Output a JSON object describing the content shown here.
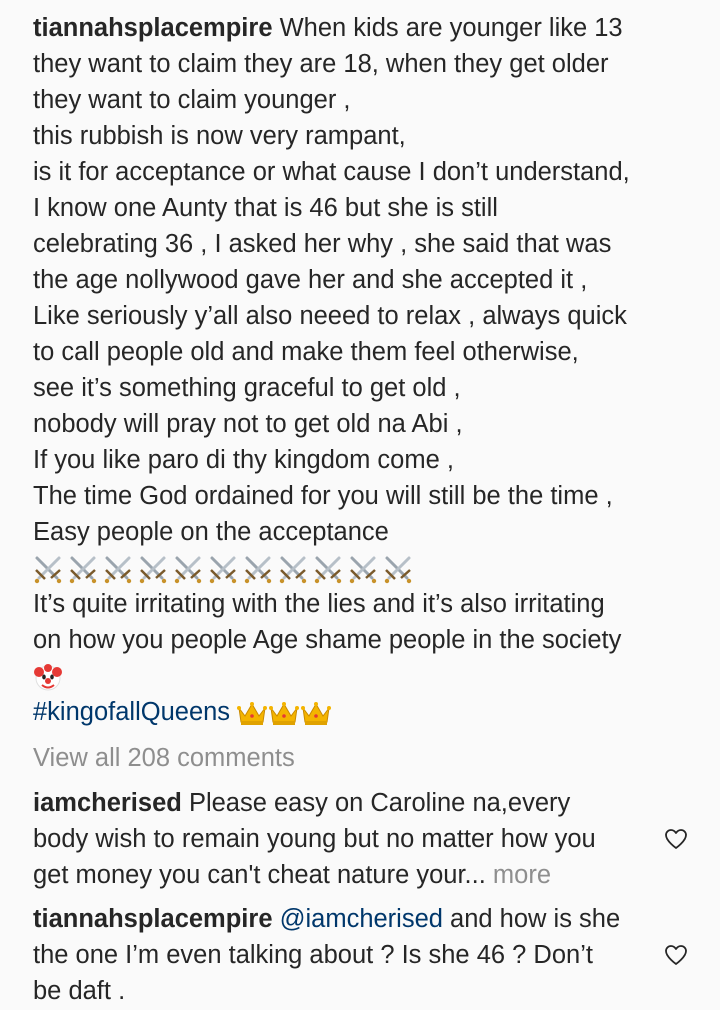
{
  "post": {
    "username": "tiannahsplacempire",
    "caption_first": "When kids are younger like 13",
    "lines": [
      "they want to claim they are 18, when they get older",
      "they want to claim younger ,",
      "this rubbish is now very rampant,",
      "is it for acceptance or what cause I don’t understand,",
      "I know one Aunty that is 46 but she is still",
      "celebrating 36 , I asked her why , she said that was",
      "the age nollywood gave her and she accepted it ,",
      "Like seriously y’all also neeed to relax , always quick",
      "to call people old and make them feel otherwise,",
      "see it’s something graceful to get old ,",
      "nobody will pray not to get old na Abi ,",
      "If you like paro di thy kingdom come ,",
      "The time God ordained for you will still be the time ,",
      "Easy people on the acceptance"
    ],
    "sword_emoji_count": 11,
    "lines_after": [
      "It’s quite irritating with the lies and it’s also irritating",
      "on how you people Age shame people in the society"
    ],
    "clown_emoji": "clown-face-icon",
    "hashtag": "#kingofallQueens",
    "crown_emoji_count": 3
  },
  "view_all_comments": "View all 208 comments",
  "comments": [
    {
      "username": "iamcherised",
      "text_line1": "Please easy on Caroline na,every",
      "text_line2": "body wish to remain young but no matter how you",
      "text_line3": "get money you can't cheat nature your...",
      "more": "more"
    },
    {
      "username": "tiannahsplacempire",
      "mention": "@iamcherised",
      "text_line1": "and how is she",
      "text_line2": "the one I’m even talking about ? Is she 46 ? Don’t",
      "text_line3": "be daft ."
    }
  ],
  "colors": {
    "background": "#fafafa",
    "text": "#262626",
    "link": "#00376b",
    "muted": "#8e8e8e"
  }
}
